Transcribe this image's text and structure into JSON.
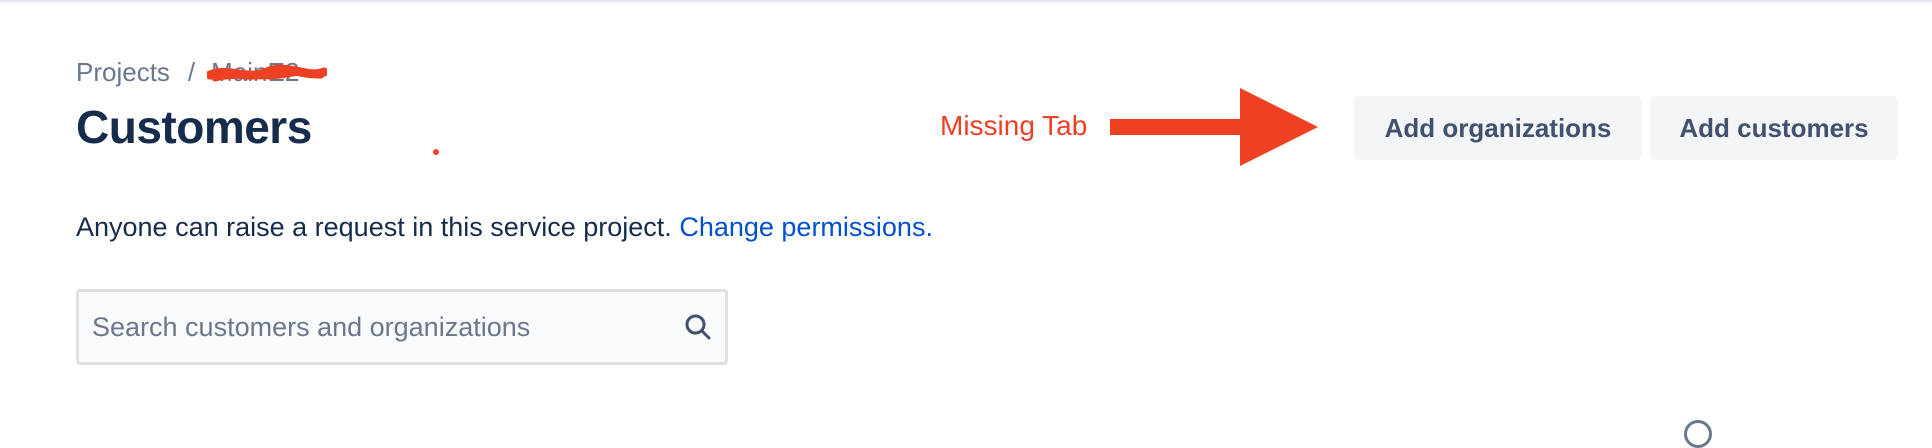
{
  "breadcrumb": {
    "root": "Projects",
    "separator": "/",
    "project": "MainE2"
  },
  "header": {
    "title": "Customers"
  },
  "annotation": {
    "text": "Missing Tab",
    "color": "#EE4124"
  },
  "actions": {
    "add_organizations": "Add organizations",
    "add_customers": "Add customers"
  },
  "info": {
    "text": "Anyone can raise a request in this service project.",
    "link": "Change permissions."
  },
  "search": {
    "placeholder": "Search customers and organizations",
    "value": ""
  },
  "icons": {
    "search": "search-icon",
    "arrow": "arrow-right-icon"
  },
  "colors": {
    "link": "#0052CC",
    "title": "#172B4D",
    "muted": "#6B778C",
    "button_bg": "#F4F5F7",
    "button_text": "#42526E"
  }
}
